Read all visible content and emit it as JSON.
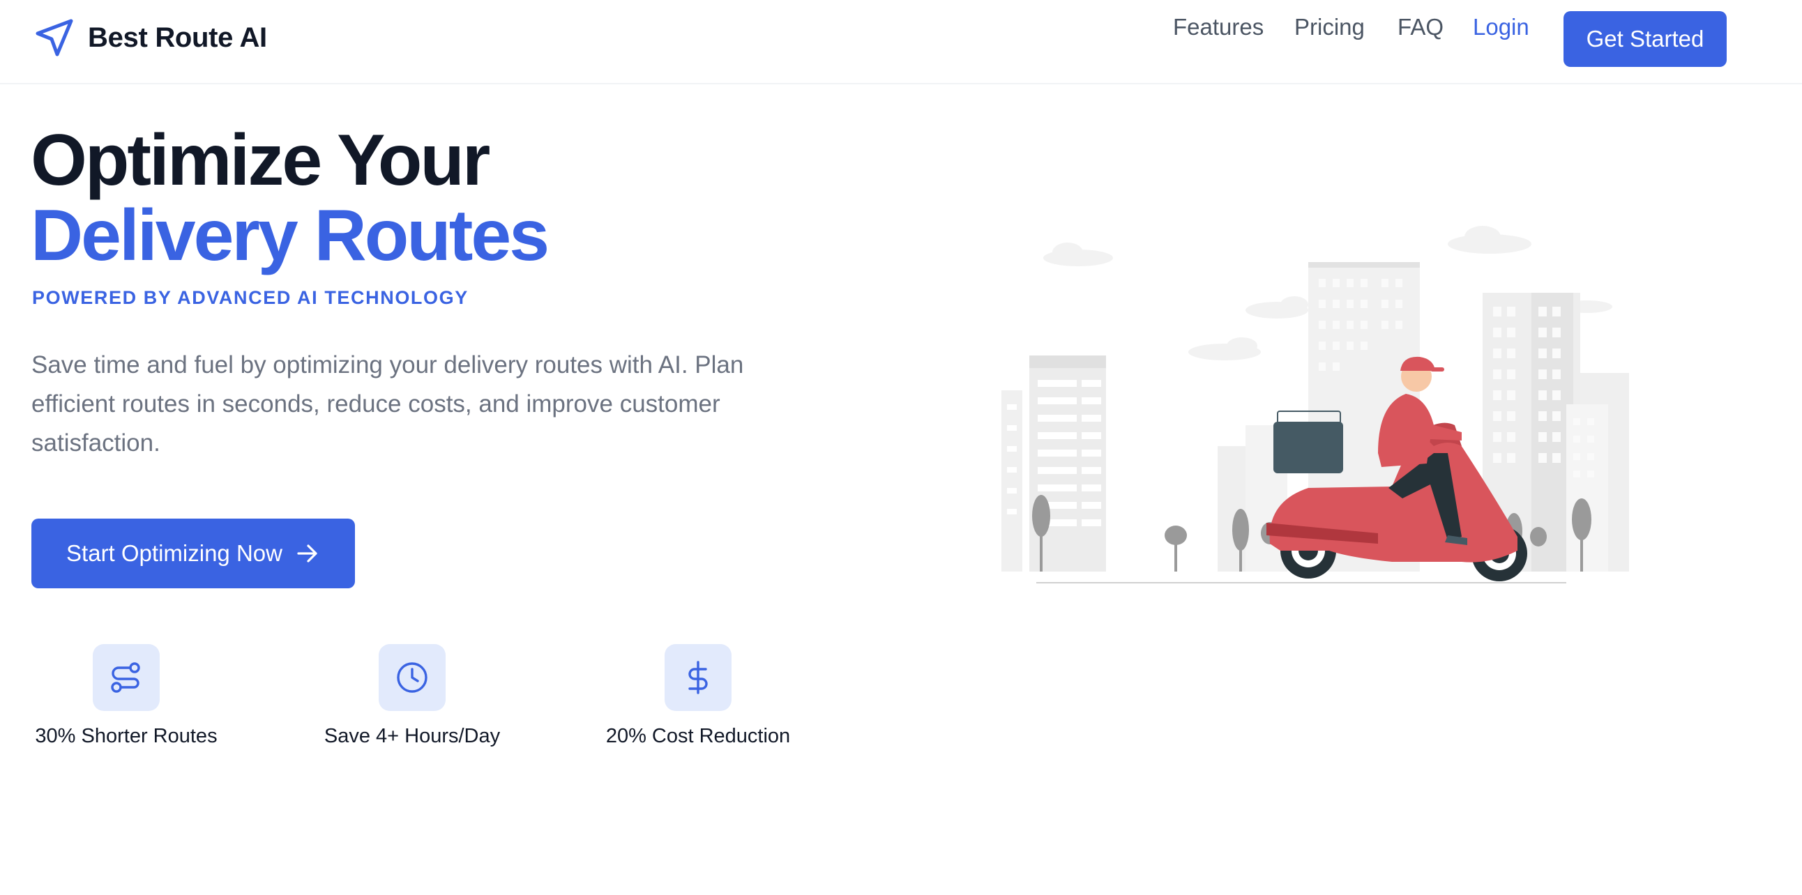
{
  "header": {
    "brand": "Best Route AI",
    "nav": {
      "features": "Features",
      "pricing": "Pricing",
      "faq": "FAQ",
      "login": "Login",
      "get_started": "Get Started"
    }
  },
  "hero": {
    "title_line1": "Optimize Your",
    "title_line2": "Delivery Routes",
    "tagline": "POWERED BY ADVANCED AI TECHNOLOGY",
    "description": "Save time and fuel by optimizing your delivery routes with AI. Plan efficient routes in seconds, reduce costs, and improve customer satisfaction.",
    "cta": "Start Optimizing Now"
  },
  "stats": [
    {
      "icon": "route-icon",
      "label": "30% Shorter Routes"
    },
    {
      "icon": "clock-icon",
      "label": "Save 4+ Hours/Day"
    },
    {
      "icon": "dollar-icon",
      "label": "20% Cost Reduction"
    }
  ],
  "colors": {
    "accent": "#3a63e2",
    "accent_light": "#e2eafc",
    "text_dark": "#111827",
    "text_muted": "#6b7280",
    "scooter_red": "#d9555c"
  },
  "icons": {
    "logo": "navigation-arrow-icon",
    "cta_arrow": "arrow-right-icon",
    "illustration": "delivery-scooter-illustration"
  }
}
